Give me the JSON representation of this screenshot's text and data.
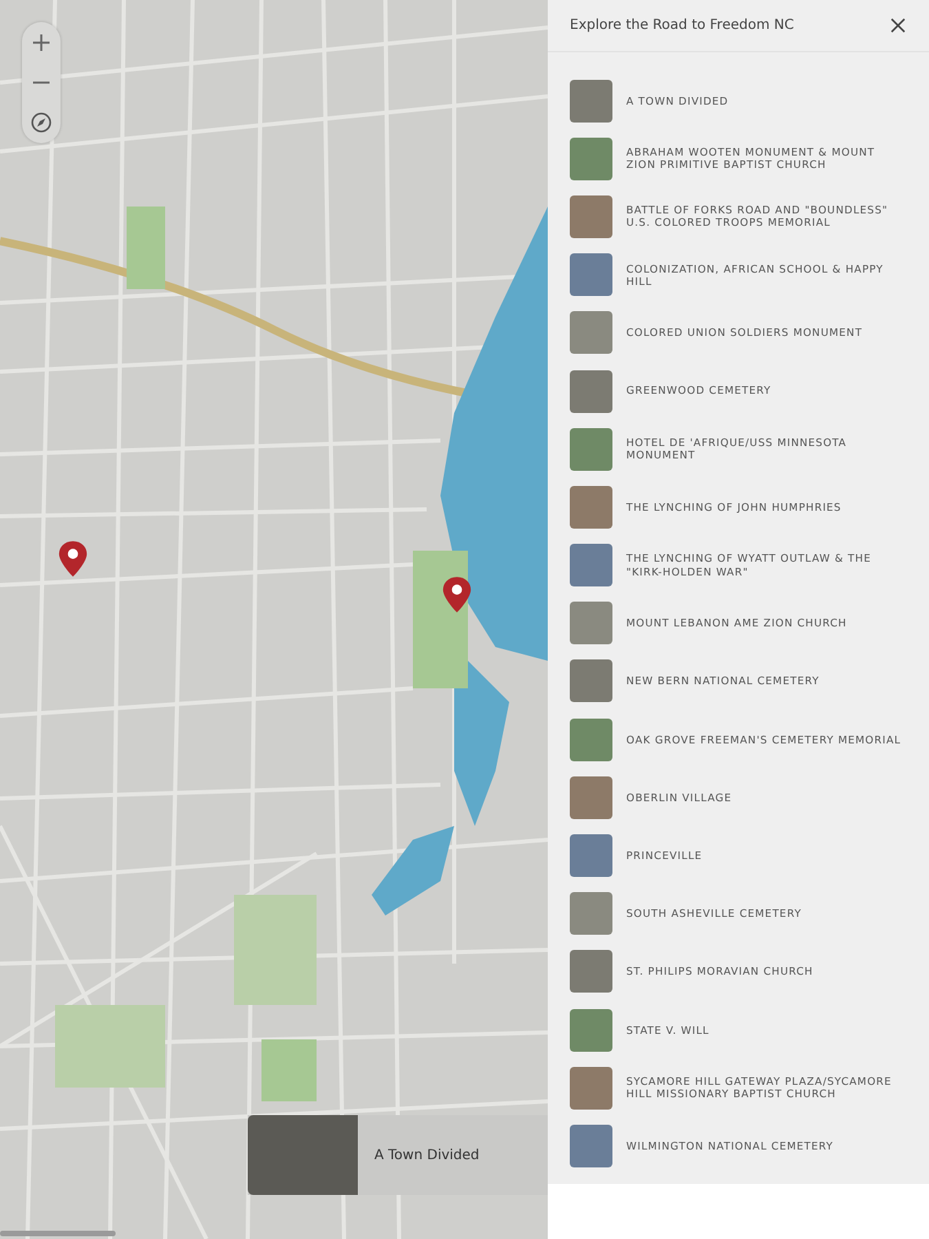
{
  "panel": {
    "title": "Explore the Road to Freedom NC"
  },
  "places": [
    {
      "name": "A TOWN DIVIDED"
    },
    {
      "name": "ABRAHAM WOOTEN MONUMENT & MOUNT ZION PRIMITIVE BAPTIST CHURCH"
    },
    {
      "name": "BATTLE OF FORKS ROAD AND \"BOUNDLESS\" U.S. COLORED TROOPS MEMORIAL"
    },
    {
      "name": "COLONIZATION, AFRICAN SCHOOL & HAPPY HILL"
    },
    {
      "name": "COLORED UNION SOLDIERS MONUMENT"
    },
    {
      "name": "GREENWOOD CEMETERY"
    },
    {
      "name": "HOTEL DE 'AFRIQUE/USS MINNESOTA MONUMENT"
    },
    {
      "name": "THE LYNCHING OF JOHN HUMPHRIES"
    },
    {
      "name": "THE LYNCHING OF WYATT OUTLAW & THE \"KIRK-HOLDEN WAR\""
    },
    {
      "name": "MOUNT LEBANON AME ZION CHURCH"
    },
    {
      "name": "NEW BERN NATIONAL CEMETERY"
    },
    {
      "name": "OAK GROVE FREEMAN'S CEMETERY MEMORIAL"
    },
    {
      "name": "OBERLIN VILLAGE"
    },
    {
      "name": "PRINCEVILLE"
    },
    {
      "name": "SOUTH ASHEVILLE CEMETERY"
    },
    {
      "name": "ST. PHILIPS MORAVIAN CHURCH"
    },
    {
      "name": "STATE V. WILL"
    },
    {
      "name": "SYCAMORE HILL GATEWAY PLAZA/SYCAMORE HILL MISSIONARY BAPTIST CHURCH"
    },
    {
      "name": "WILMINGTON NATIONAL CEMETERY"
    }
  ],
  "preview": {
    "title": "A Town Divided"
  }
}
